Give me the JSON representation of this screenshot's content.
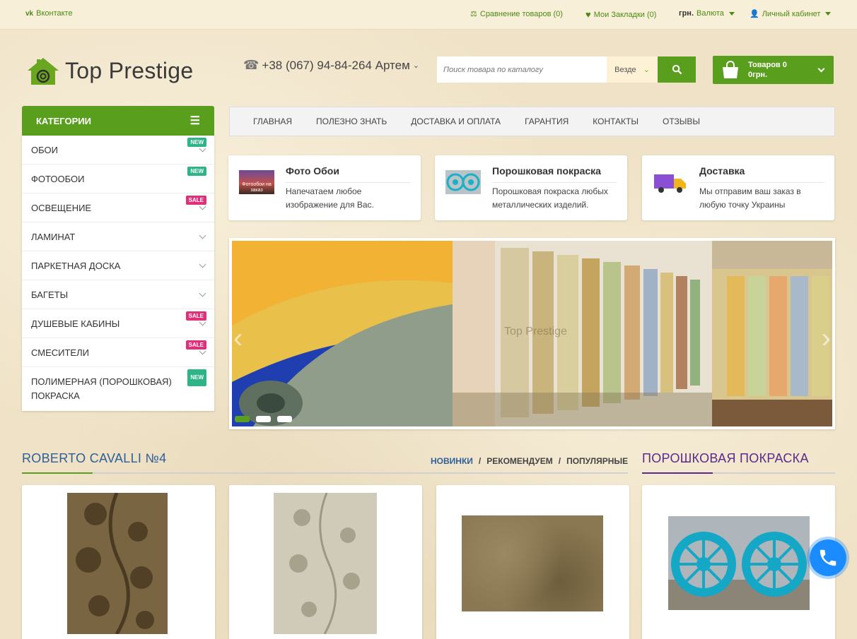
{
  "topbar": {
    "vk": "Вконтакте",
    "compare": "Сравнение товаров (0)",
    "bookmarks": "Мои Закладки (0)",
    "currency_code": "грн.",
    "currency_label": "Валюта",
    "account": "Личный кабинет"
  },
  "header": {
    "logo_text": "Top Prestige",
    "phone": "+38 (067) 94-84-264 Артем",
    "search_placeholder": "Поиск товара по каталогу",
    "search_scope": "Везде",
    "cart_line1": "Товаров 0",
    "cart_line2": "0грн."
  },
  "categories": {
    "title": "КАТЕГОРИИ",
    "items": [
      {
        "label": "ОБОИ",
        "badge": "NEW"
      },
      {
        "label": "ФОТООБОИ",
        "badge": "NEW"
      },
      {
        "label": "ОСВЕЩЕНИЕ",
        "badge": "SALE"
      },
      {
        "label": "ЛАМИНАТ",
        "badge": ""
      },
      {
        "label": "ПАРКЕТНАЯ ДОСКА",
        "badge": ""
      },
      {
        "label": "БАГЕТЫ",
        "badge": ""
      },
      {
        "label": "ДУШЕВЫЕ КАБИНЫ",
        "badge": "SALE"
      },
      {
        "label": "СМЕСИТЕЛИ",
        "badge": "SALE"
      },
      {
        "label": "ПОЛИМЕРНАЯ (ПОРОШКОВАЯ) ПОКРАСКА",
        "badge": "NEW"
      }
    ]
  },
  "menu": [
    "ГЛАВНАЯ",
    "ПОЛЕЗНО ЗНАТЬ",
    "ДОСТАВКА И ОПЛАТА",
    "ГАРАНТИЯ",
    "КОНТАКТЫ",
    "ОТЗЫВЫ"
  ],
  "features": [
    {
      "title": "Фото Обои",
      "desc": "Напечатаем любое изображение для Вас.",
      "pic_text": "Фотообои на заказ"
    },
    {
      "title": "Порошковая покраска",
      "desc": "Порошковая покраска любых металлических изделий."
    },
    {
      "title": "Доставка",
      "desc": "Мы отправим ваш заказ в любую точку Украины"
    }
  ],
  "slider": {
    "watermark": "Top Prestige",
    "slides": 3,
    "active": 1
  },
  "section1": {
    "title": "ROBERTO CAVALLI №4",
    "tab_new": "НОВИНКИ",
    "tab_rec": "РЕКОМЕНДУЕМ",
    "tab_pop": "ПОПУЛЯРНЫЕ",
    "sep": "/"
  },
  "section2": {
    "title": "ПОРОШКОВАЯ ПОКРАСКА"
  },
  "colors": {
    "brand_green": "#5a9e1e",
    "sale": "#e0307a",
    "new": "#2fb487",
    "title_blue": "#2d5f9a",
    "title_purple": "#5a2a8a"
  }
}
